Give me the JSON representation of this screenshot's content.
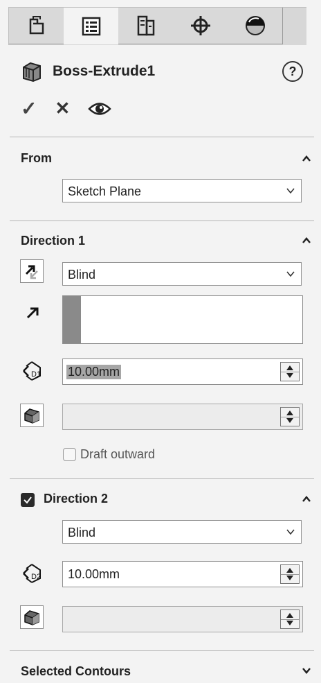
{
  "tabs": [
    {
      "icon": "feature-manager-icon"
    },
    {
      "icon": "property-manager-icon",
      "active": true
    },
    {
      "icon": "configuration-manager-icon"
    },
    {
      "icon": "dimxpert-manager-icon"
    },
    {
      "icon": "display-manager-icon"
    }
  ],
  "header": {
    "title": "Boss-Extrude1",
    "help": "?"
  },
  "actions": {
    "ok": "✓",
    "cancel": "✕",
    "preview": "eye-icon"
  },
  "from": {
    "title": "From",
    "value": "Sketch Plane"
  },
  "direction1": {
    "title": "Direction 1",
    "end_condition": "Blind",
    "depth": "10.00mm",
    "draft_label": "Draft outward",
    "draft_checked": false
  },
  "direction2": {
    "title": "Direction 2",
    "enabled": true,
    "end_condition": "Blind",
    "depth": "10.00mm"
  },
  "selected_contours": {
    "title": "Selected Contours"
  }
}
